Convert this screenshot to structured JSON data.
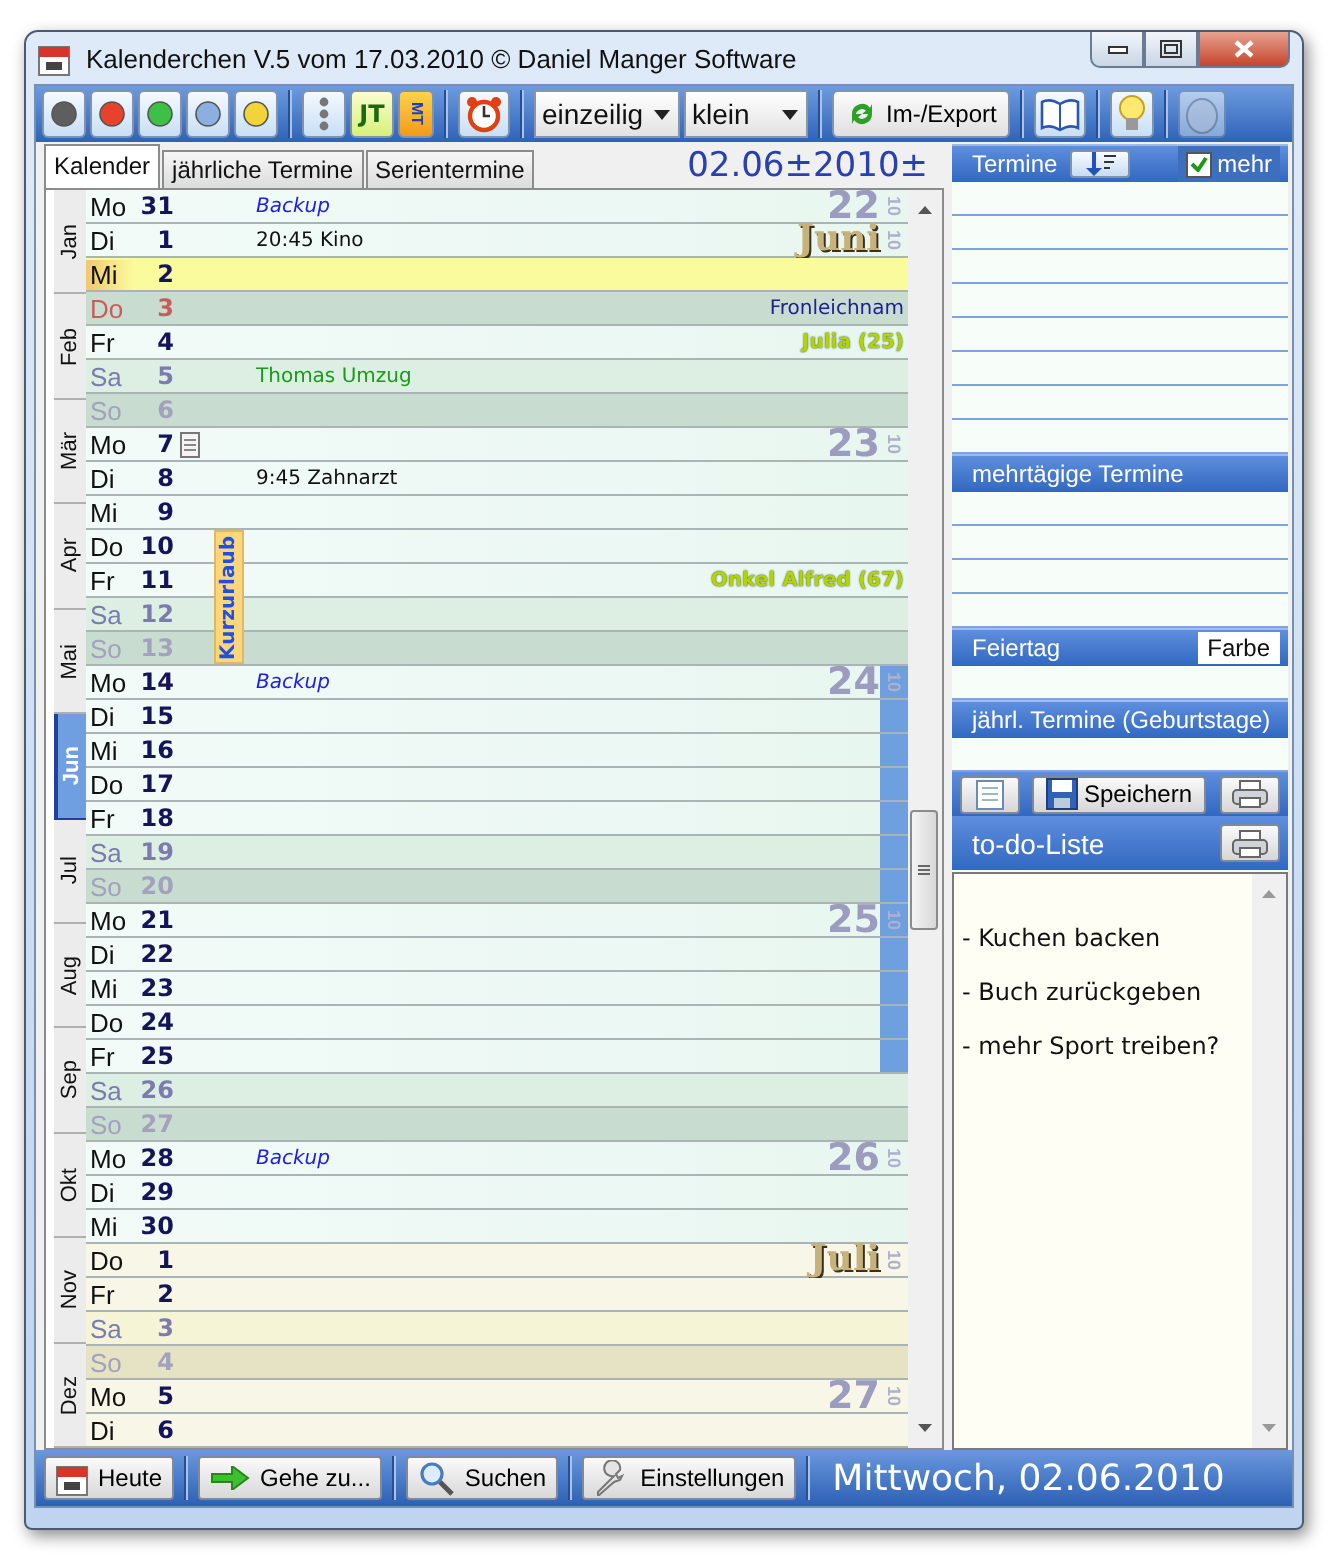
{
  "window": {
    "title": "Kalenderchen V.5 vom 17.03.2010 © Daniel Manger Software"
  },
  "toolbar": {
    "items": [
      {
        "kind": "color",
        "color": "#5e5e5e"
      },
      {
        "kind": "color",
        "color": "#e8412c"
      },
      {
        "kind": "color",
        "color": "#3cc045"
      },
      {
        "kind": "color",
        "color": "#8bb0e0"
      },
      {
        "kind": "color",
        "color": "#f3d33a"
      },
      {
        "kind": "separator"
      },
      {
        "kind": "dots"
      },
      {
        "kind": "text",
        "label": "JT"
      },
      {
        "kind": "vertical_text",
        "label": "MT"
      },
      {
        "kind": "separator"
      },
      {
        "kind": "alarm"
      },
      {
        "kind": "separator"
      },
      {
        "kind": "select",
        "value": "einzeilig"
      },
      {
        "kind": "select",
        "value": "klein"
      },
      {
        "kind": "separator"
      },
      {
        "kind": "export",
        "label": "Im-/Export"
      },
      {
        "kind": "separator"
      },
      {
        "kind": "book"
      },
      {
        "kind": "separator"
      },
      {
        "kind": "bulb"
      },
      {
        "kind": "separator"
      },
      {
        "kind": "egg",
        "disabled": true
      }
    ]
  },
  "tabs": [
    {
      "label": "Kalender",
      "selected": true
    },
    {
      "label": "jährliche Termine",
      "selected": false
    },
    {
      "label": "Serientermine",
      "selected": false
    }
  ],
  "date_display": "02.06±2010±",
  "months": [
    {
      "label": "Jan",
      "selected": false
    },
    {
      "label": "Feb",
      "selected": false
    },
    {
      "label": "Mär",
      "selected": false
    },
    {
      "label": "Apr",
      "selected": false
    },
    {
      "label": "Mai",
      "selected": false
    },
    {
      "label": "Jun",
      "selected": true
    },
    {
      "label": "Jul",
      "selected": false
    },
    {
      "label": "Aug",
      "selected": false
    },
    {
      "label": "Sep",
      "selected": false
    },
    {
      "label": "Okt",
      "selected": false
    },
    {
      "label": "Nov",
      "selected": false
    },
    {
      "label": "Dez",
      "selected": false
    }
  ],
  "multi_day_label": "Kurzurlaub",
  "rows": [
    {
      "weekday": "Mo",
      "day": "31",
      "kind": "weekday",
      "event": {
        "text": "Backup",
        "kind": "series"
      },
      "week": "22",
      "year": "10"
    },
    {
      "weekday": "Di",
      "day": "1",
      "kind": "weekday",
      "event": {
        "text": "20:45 Kino",
        "kind": "plain"
      },
      "month_label": "Juni",
      "year": "10"
    },
    {
      "weekday": "Mi",
      "day": "2",
      "kind": "today"
    },
    {
      "weekday": "Do",
      "day": "3",
      "kind": "holiday",
      "holiday": "Fronleichnam"
    },
    {
      "weekday": "Fr",
      "day": "4",
      "kind": "weekday",
      "birthday": "Julia (25)"
    },
    {
      "weekday": "Sa",
      "day": "5",
      "kind": "saturday",
      "event": {
        "text": "Thomas Umzug",
        "kind": "highlight"
      }
    },
    {
      "weekday": "So",
      "day": "6",
      "kind": "sunday"
    },
    {
      "weekday": "Mo",
      "day": "7",
      "kind": "weekday",
      "note": true,
      "week": "23",
      "year": "10"
    },
    {
      "weekday": "Di",
      "day": "8",
      "kind": "weekday",
      "event": {
        "text": "9:45 Zahnarzt",
        "kind": "plain"
      }
    },
    {
      "weekday": "Mi",
      "day": "9",
      "kind": "weekday"
    },
    {
      "weekday": "Do",
      "day": "10",
      "kind": "weekday",
      "in_multi_day": true
    },
    {
      "weekday": "Fr",
      "day": "11",
      "kind": "weekday",
      "in_multi_day": true,
      "birthday": "Onkel Alfred (67)"
    },
    {
      "weekday": "Sa",
      "day": "12",
      "kind": "saturday",
      "in_multi_day": true
    },
    {
      "weekday": "So",
      "day": "13",
      "kind": "sunday",
      "in_multi_day": true
    },
    {
      "weekday": "Mo",
      "day": "14",
      "kind": "weekday",
      "event": {
        "text": "Backup",
        "kind": "series"
      },
      "week": "24",
      "year": "10",
      "marked": true
    },
    {
      "weekday": "Di",
      "day": "15",
      "kind": "weekday",
      "marked": true
    },
    {
      "weekday": "Mi",
      "day": "16",
      "kind": "weekday",
      "marked": true
    },
    {
      "weekday": "Do",
      "day": "17",
      "kind": "weekday",
      "marked": true
    },
    {
      "weekday": "Fr",
      "day": "18",
      "kind": "weekday",
      "marked": true
    },
    {
      "weekday": "Sa",
      "day": "19",
      "kind": "saturday",
      "marked": true
    },
    {
      "weekday": "So",
      "day": "20",
      "kind": "sunday",
      "marked": true
    },
    {
      "weekday": "Mo",
      "day": "21",
      "kind": "weekday",
      "week": "25",
      "year": "10",
      "marked": true
    },
    {
      "weekday": "Di",
      "day": "22",
      "kind": "weekday",
      "marked": true
    },
    {
      "weekday": "Mi",
      "day": "23",
      "kind": "weekday",
      "marked": true
    },
    {
      "weekday": "Do",
      "day": "24",
      "kind": "weekday",
      "marked": true
    },
    {
      "weekday": "Fr",
      "day": "25",
      "kind": "weekday",
      "marked": true
    },
    {
      "weekday": "Sa",
      "day": "26",
      "kind": "saturday"
    },
    {
      "weekday": "So",
      "day": "27",
      "kind": "sunday"
    },
    {
      "weekday": "Mo",
      "day": "28",
      "kind": "weekday",
      "event": {
        "text": "Backup",
        "kind": "series"
      },
      "week": "26",
      "year": "10"
    },
    {
      "weekday": "Di",
      "day": "29",
      "kind": "weekday"
    },
    {
      "weekday": "Mi",
      "day": "30",
      "kind": "weekday"
    },
    {
      "weekday": "Do",
      "day": "1",
      "kind": "weekday",
      "other_month": true,
      "month_label": "Juli",
      "year": "10"
    },
    {
      "weekday": "Fr",
      "day": "2",
      "kind": "weekday",
      "other_month": true
    },
    {
      "weekday": "Sa",
      "day": "3",
      "kind": "saturday",
      "other_month": true
    },
    {
      "weekday": "So",
      "day": "4",
      "kind": "sunday",
      "other_month": true
    },
    {
      "weekday": "Mo",
      "day": "5",
      "kind": "weekday",
      "other_month": true,
      "week": "27",
      "year": "10"
    },
    {
      "weekday": "Di",
      "day": "6",
      "kind": "weekday",
      "other_month": true
    }
  ],
  "side": {
    "appointments": {
      "title": "Termine",
      "more": {
        "label": "mehr",
        "checked": true
      }
    },
    "multi_day": {
      "title": "mehrtägige Termine"
    },
    "holiday": {
      "title": "Feiertag",
      "button": "Farbe"
    },
    "annual": {
      "title": "jährl. Termine (Geburtstage)"
    },
    "save_button": "Speichern",
    "todo": {
      "title": "to-do-Liste",
      "lines": [
        "- Kuchen backen",
        "- Buch zurückgeben",
        "- mehr Sport treiben?"
      ]
    }
  },
  "footer": {
    "buttons": [
      {
        "kind": "today",
        "label": "Heute"
      },
      {
        "kind": "goto",
        "label": "Gehe zu..."
      },
      {
        "kind": "search",
        "label": "Suchen"
      },
      {
        "kind": "settings",
        "label": "Einstellungen"
      }
    ],
    "date": "Mittwoch, 02.06.2010"
  }
}
